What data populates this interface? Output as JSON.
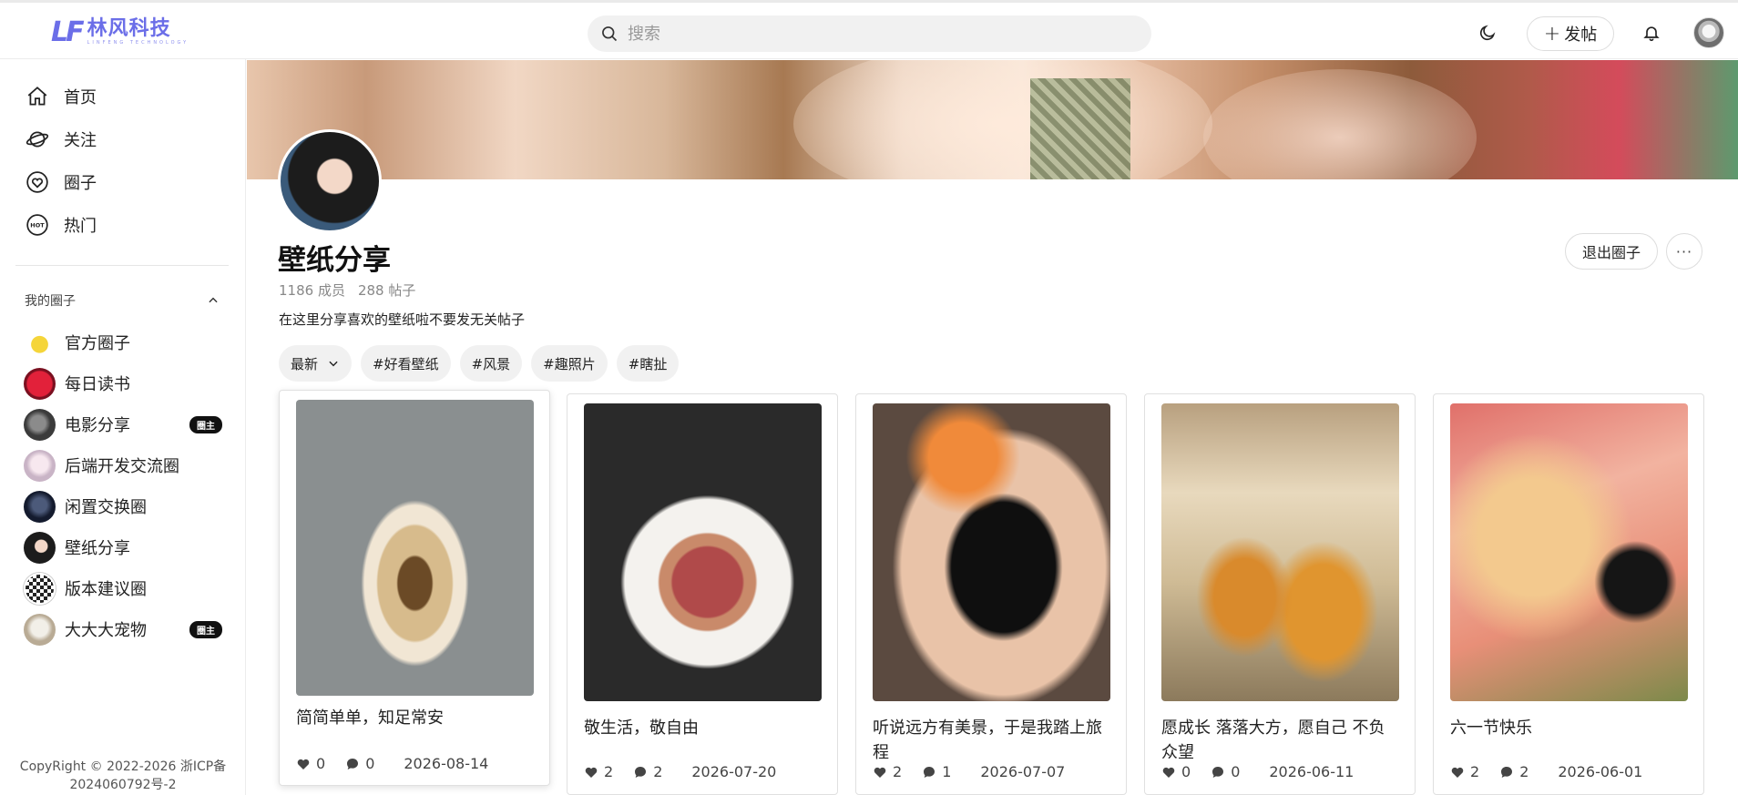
{
  "header": {
    "logo_mark": "LF",
    "logo_name": "林风科技",
    "logo_sub": "LINFENG TECHNOLOGY",
    "search_placeholder": "搜索",
    "post_label": "发帖"
  },
  "sidebar": {
    "nav": [
      {
        "label": "首页",
        "icon": "home-icon"
      },
      {
        "label": "关注",
        "icon": "planet-icon"
      },
      {
        "label": "圈子",
        "icon": "heart-circle-icon"
      },
      {
        "label": "热门",
        "icon": "hot-icon"
      }
    ],
    "my_circles_title": "我的圈子",
    "circles": [
      {
        "label": "官方圈子",
        "badge": ""
      },
      {
        "label": "每日读书",
        "badge": ""
      },
      {
        "label": "电影分享",
        "badge": "圈主"
      },
      {
        "label": "后端开发交流圈",
        "badge": ""
      },
      {
        "label": "闲置交换圈",
        "badge": ""
      },
      {
        "label": "壁纸分享",
        "badge": ""
      },
      {
        "label": "版本建议圈",
        "badge": ""
      },
      {
        "label": "大大大宠物",
        "badge": "圈主"
      }
    ],
    "copyright_line1": "CopyRight © 2022-2026 浙ICP备",
    "copyright_line2": "2024060792号-2"
  },
  "circle": {
    "title": "壁纸分享",
    "members": "1186 成员",
    "posts": "288 帖子",
    "description": "在这里分享喜欢的壁纸啦不要发无关帖子",
    "quit_label": "退出圈子",
    "more_label": "···"
  },
  "filters": {
    "sort": "最新",
    "tags": [
      "#好看壁纸",
      "#风景",
      "#趣照片",
      "#瞎扯"
    ]
  },
  "posts": [
    {
      "title": "简简单单，知足常安",
      "likes": "0",
      "comments": "0",
      "date": "2026-08-14"
    },
    {
      "title": "敬生活，敬自由",
      "likes": "2",
      "comments": "2",
      "date": "2026-07-20"
    },
    {
      "title": "听说远方有美景，于是我踏上旅程",
      "likes": "2",
      "comments": "1",
      "date": "2026-07-07"
    },
    {
      "title": "愿成长 落落大方，愿自己 不负众望",
      "likes": "0",
      "comments": "0",
      "date": "2026-06-11"
    },
    {
      "title": "六一节快乐",
      "likes": "2",
      "comments": "2",
      "date": "2026-06-01"
    }
  ]
}
